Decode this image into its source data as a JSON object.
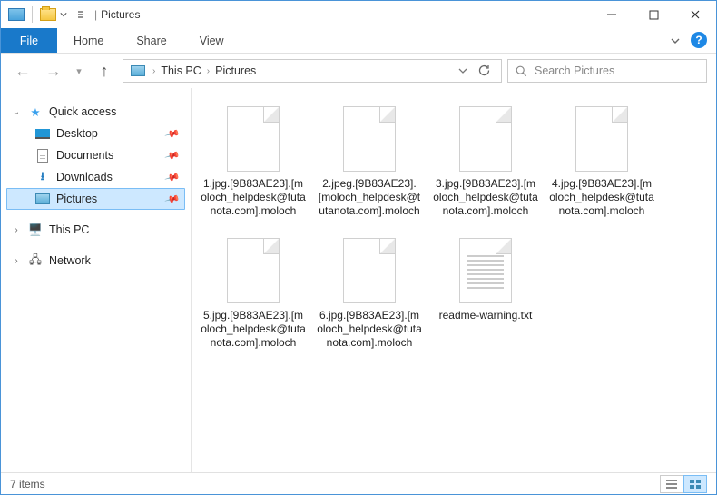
{
  "window": {
    "title": "Pictures"
  },
  "ribbon": {
    "file": "File",
    "tabs": [
      "Home",
      "Share",
      "View"
    ]
  },
  "breadcrumb": {
    "root_chev": "›",
    "items": [
      "This PC",
      "Pictures"
    ]
  },
  "search": {
    "placeholder": "Search Pictures"
  },
  "nav": {
    "quick_access": {
      "label": "Quick access",
      "items": [
        {
          "label": "Desktop"
        },
        {
          "label": "Documents"
        },
        {
          "label": "Downloads"
        },
        {
          "label": "Pictures"
        }
      ]
    },
    "this_pc": "This PC",
    "network": "Network"
  },
  "files": [
    {
      "name": "1.jpg.[9B83AE23].[moloch_helpdesk@tutanota.com].moloch",
      "type": "file"
    },
    {
      "name": "2.jpeg.[9B83AE23].[moloch_helpdesk@tutanota.com].moloch",
      "type": "file"
    },
    {
      "name": "3.jpg.[9B83AE23].[moloch_helpdesk@tutanota.com].moloch",
      "type": "file"
    },
    {
      "name": "4.jpg.[9B83AE23].[moloch_helpdesk@tutanota.com].moloch",
      "type": "file"
    },
    {
      "name": "5.jpg.[9B83AE23].[moloch_helpdesk@tutanota.com].moloch",
      "type": "file"
    },
    {
      "name": "6.jpg.[9B83AE23].[moloch_helpdesk@tutanota.com].moloch",
      "type": "file"
    },
    {
      "name": "readme-warning.txt",
      "type": "txt"
    }
  ],
  "status": {
    "count_text": "7 items"
  }
}
